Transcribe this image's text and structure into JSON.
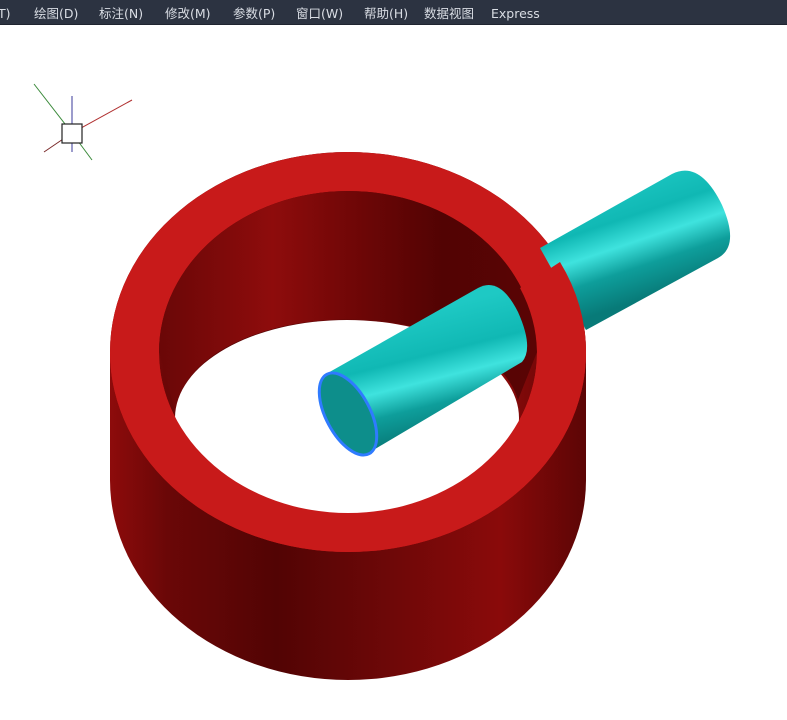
{
  "menubar": {
    "items": [
      {
        "id": "tools",
        "label": "T)"
      },
      {
        "id": "draw",
        "label": "绘图(D)"
      },
      {
        "id": "dimension",
        "label": "标注(N)"
      },
      {
        "id": "modify",
        "label": "修改(M)"
      },
      {
        "id": "parametric",
        "label": "参数(P)"
      },
      {
        "id": "window",
        "label": "窗口(W)"
      },
      {
        "id": "help",
        "label": "帮助(H)"
      },
      {
        "id": "dataview",
        "label": "数据视图"
      },
      {
        "id": "express",
        "label": "Express"
      }
    ]
  },
  "viewport": {
    "background": "#ffffff",
    "ucs_icon": "ucs-axis-icon",
    "objects": [
      {
        "name": "outer-ring-cylinder",
        "color": "#c81a1a"
      },
      {
        "name": "pipe-cylinder",
        "color": "#12c4c0",
        "selected_edge_color": "#2f7bff"
      }
    ]
  }
}
